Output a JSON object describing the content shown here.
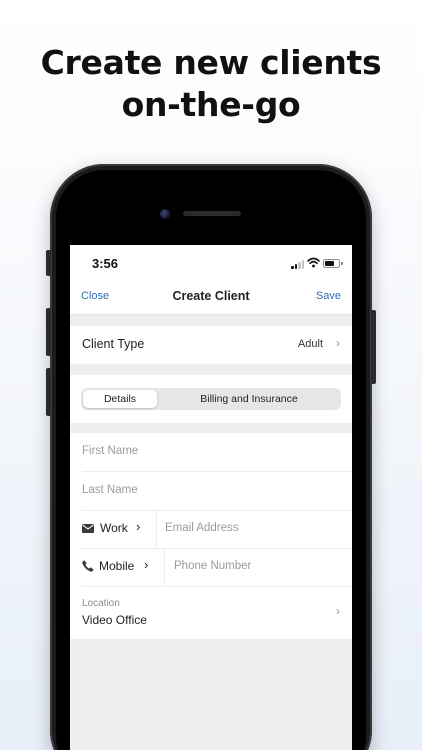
{
  "promo": {
    "headline_line1": "Create new clients",
    "headline_line2": "on-the-go"
  },
  "status_bar": {
    "time": "3:56"
  },
  "nav": {
    "close": "Close",
    "title": "Create Client",
    "save": "Save"
  },
  "client_type": {
    "label": "Client Type",
    "value": "Adult",
    "chevron": "›"
  },
  "tabs": [
    {
      "label": "Details",
      "selected": true
    },
    {
      "label": "Billing and Insurance",
      "selected": false
    }
  ],
  "form": {
    "first_name": {
      "placeholder": "First Name"
    },
    "last_name": {
      "placeholder": "Last Name"
    },
    "email": {
      "type_label": "Work",
      "icon": "envelope-icon",
      "chevron": "›",
      "placeholder": "Email Address"
    },
    "phone": {
      "type_label": "Mobile",
      "icon": "phone-icon",
      "chevron": "›",
      "placeholder": "Phone Number"
    },
    "location": {
      "label": "Location",
      "value": "Video Office",
      "chevron": "›"
    }
  },
  "colors": {
    "accent": "#2e6db4",
    "background": "#eeeef0",
    "placeholder": "#9b9ba0"
  }
}
